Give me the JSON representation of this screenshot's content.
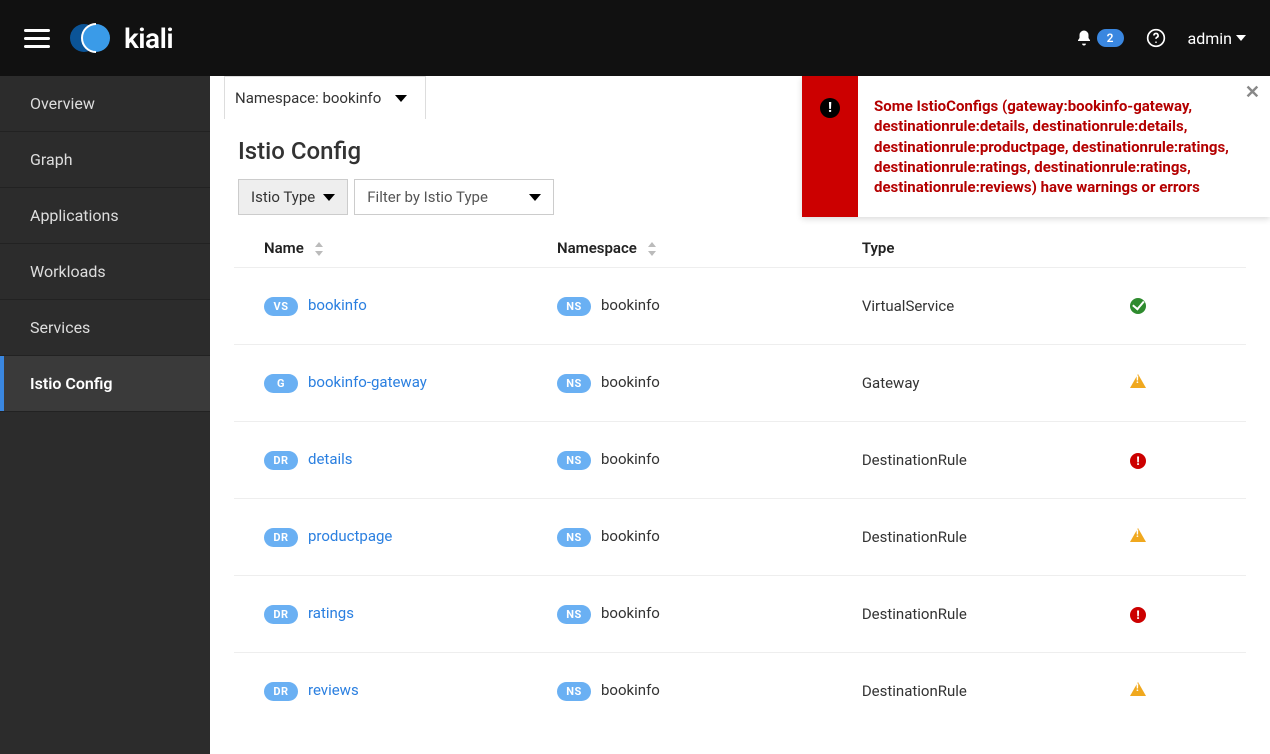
{
  "header": {
    "brand": "kiali",
    "notification_count": "2",
    "username": "admin"
  },
  "sidebar": {
    "items": [
      {
        "label": "Overview",
        "active": false
      },
      {
        "label": "Graph",
        "active": false
      },
      {
        "label": "Applications",
        "active": false
      },
      {
        "label": "Workloads",
        "active": false
      },
      {
        "label": "Services",
        "active": false
      },
      {
        "label": "Istio Config",
        "active": true
      }
    ]
  },
  "namespace_selector": "Namespace: bookinfo",
  "page_title": "Istio Config",
  "filters": {
    "type_label": "Istio Type",
    "placeholder": "Filter by Istio Type"
  },
  "table": {
    "columns": [
      "Name",
      "Namespace",
      "Type",
      ""
    ],
    "rows": [
      {
        "badge": "VS",
        "name": "bookinfo",
        "ns_badge": "NS",
        "namespace": "bookinfo",
        "type": "VirtualService",
        "status": "ok"
      },
      {
        "badge": "G",
        "name": "bookinfo-gateway",
        "ns_badge": "NS",
        "namespace": "bookinfo",
        "type": "Gateway",
        "status": "warn"
      },
      {
        "badge": "DR",
        "name": "details",
        "ns_badge": "NS",
        "namespace": "bookinfo",
        "type": "DestinationRule",
        "status": "err"
      },
      {
        "badge": "DR",
        "name": "productpage",
        "ns_badge": "NS",
        "namespace": "bookinfo",
        "type": "DestinationRule",
        "status": "warn"
      },
      {
        "badge": "DR",
        "name": "ratings",
        "ns_badge": "NS",
        "namespace": "bookinfo",
        "type": "DestinationRule",
        "status": "err"
      },
      {
        "badge": "DR",
        "name": "reviews",
        "ns_badge": "NS",
        "namespace": "bookinfo",
        "type": "DestinationRule",
        "status": "warn"
      }
    ]
  },
  "alert": {
    "text": "Some IstioConfigs (gateway:bookinfo-gateway, destinationrule:details, destinationrule:details, destinationrule:productpage, destinationrule:ratings, destinationrule:ratings, destinationrule:ratings, destinationrule:reviews) have warnings or errors"
  }
}
